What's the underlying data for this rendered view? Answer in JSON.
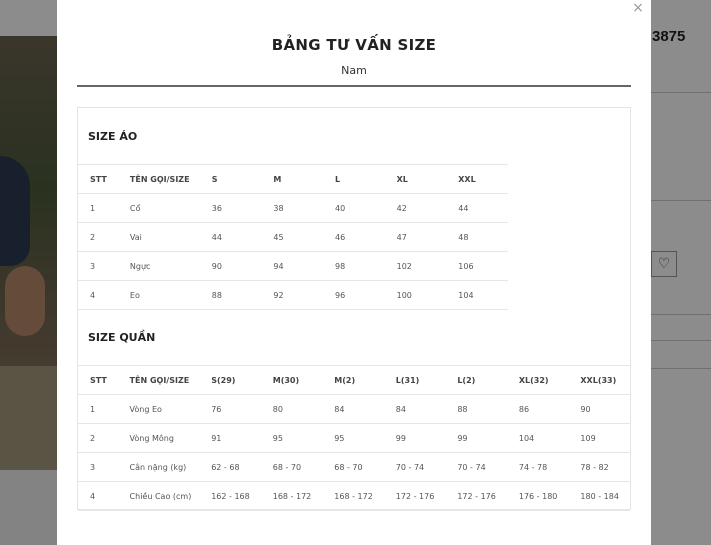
{
  "background": {
    "price_fragment": "3875",
    "heart_icon": "heart-icon"
  },
  "modal": {
    "title": "BẢNG TƯ VẤN SIZE",
    "gender_tab": "Nam",
    "close_label": "×"
  },
  "shirt_table": {
    "title": "SIZE ÁO",
    "headers": [
      "STT",
      "TÊN GỌI/SIZE",
      "S",
      "M",
      "L",
      "XL",
      "XXL"
    ],
    "rows": [
      [
        "1",
        "Cổ",
        "36",
        "38",
        "40",
        "42",
        "44"
      ],
      [
        "2",
        "Vai",
        "44",
        "45",
        "46",
        "47",
        "48"
      ],
      [
        "3",
        "Ngực",
        "90",
        "94",
        "98",
        "102",
        "106"
      ],
      [
        "4",
        "Eo",
        "88",
        "92",
        "96",
        "100",
        "104"
      ]
    ]
  },
  "pants_table": {
    "title": "SIZE QUẦN",
    "headers": [
      "STT",
      "TÊN GỌI/SIZE",
      "S(29)",
      "M(30)",
      "M(2)",
      "L(31)",
      "L(2)",
      "XL(32)",
      "XXL(33)"
    ],
    "rows": [
      [
        "1",
        "Vòng Eo",
        "76",
        "80",
        "84",
        "84",
        "88",
        "86",
        "90"
      ],
      [
        "2",
        "Vòng Mông",
        "91",
        "95",
        "95",
        "99",
        "99",
        "104",
        "109"
      ],
      [
        "3",
        "Cân nặng (kg)",
        "62 - 68",
        "68 - 70",
        "68 - 70",
        "70 - 74",
        "70 - 74",
        "74 - 78",
        "78 - 82"
      ],
      [
        "4",
        "Chiều Cao (cm)",
        "162 - 168",
        "168 - 172",
        "168 - 172",
        "172 - 176",
        "172 - 176",
        "176 - 180",
        "180 - 184"
      ]
    ]
  }
}
